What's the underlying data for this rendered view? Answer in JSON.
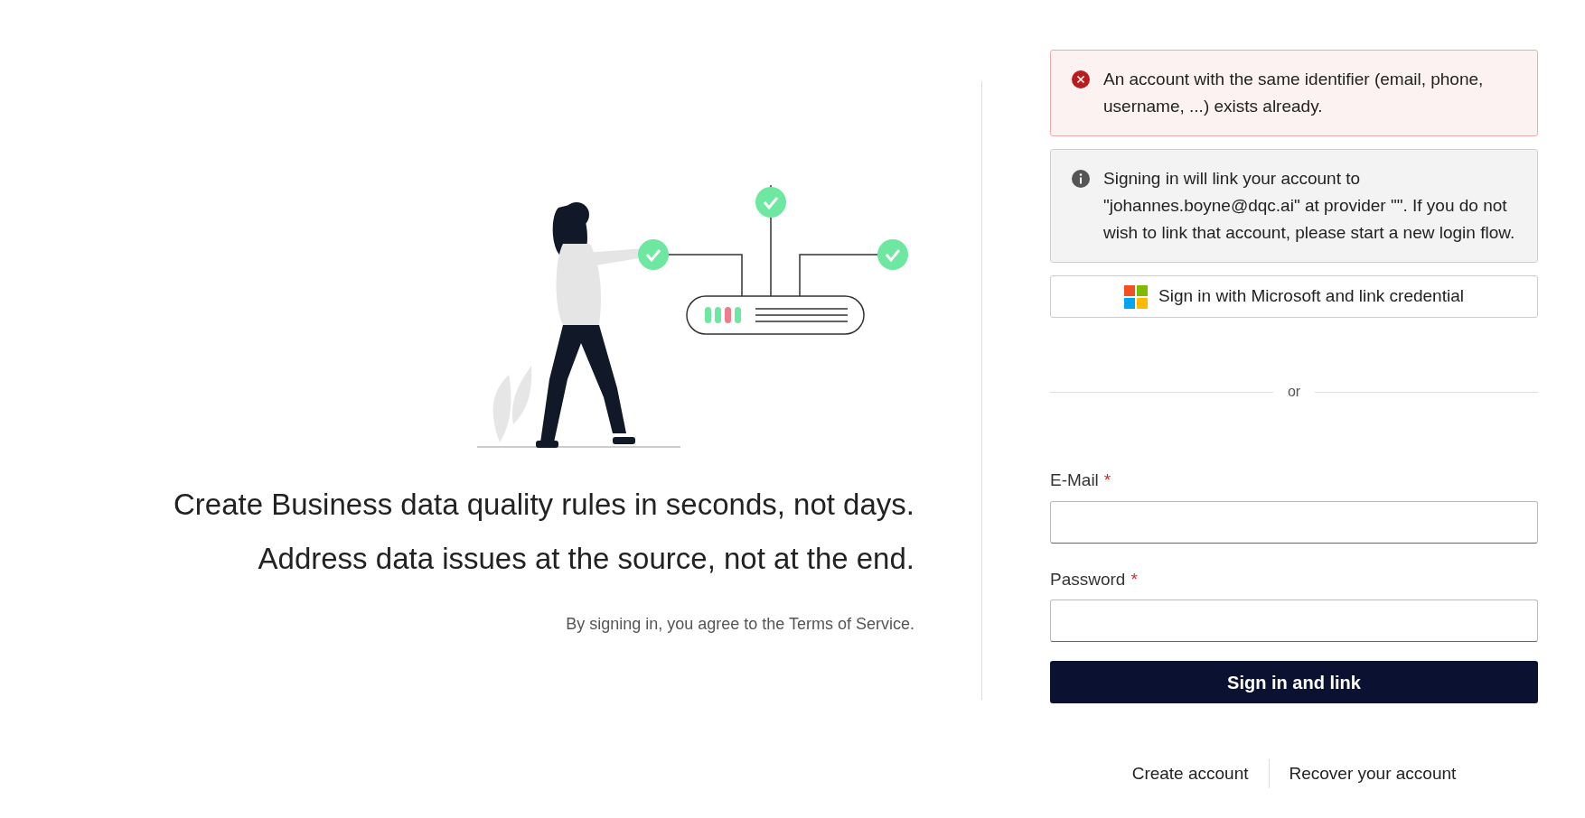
{
  "hero": {
    "taglines": [
      "Create Business data quality rules in seconds, not days.",
      "Address data issues at the source, not at the end."
    ],
    "terms": "By signing in, you agree to the Terms of Service."
  },
  "alerts": [
    {
      "kind": "error",
      "text": "An account with the same identifier (email, phone, username, ...) exists already."
    },
    {
      "kind": "info",
      "text": "Signing in will link your account to \"johannes.boyne@dqc.ai\" at provider \"\". If you do not wish to link that account, please start a new login flow."
    }
  ],
  "social_button": {
    "label": "Sign in with Microsoft and link credential"
  },
  "divider": {
    "label": "or"
  },
  "fields": [
    {
      "label": "E-Mail",
      "required_mark": "*"
    },
    {
      "label": "Password",
      "required_mark": "*"
    }
  ],
  "submit": {
    "label": "Sign in and link"
  },
  "links": [
    "Create account",
    "Recover your account"
  ]
}
